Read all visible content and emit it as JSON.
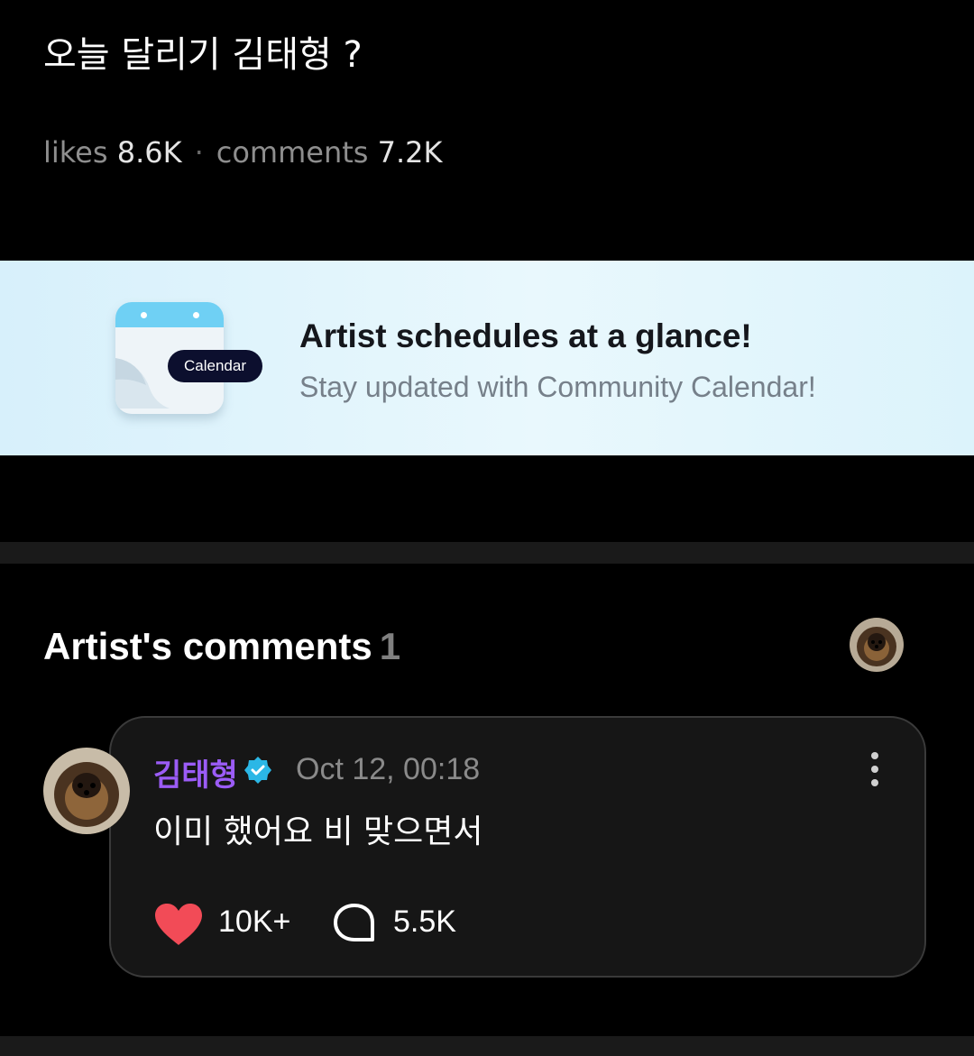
{
  "post": {
    "title": "오늘 달리기 김태형 ?",
    "likes_label": "likes",
    "likes_value": "8.6K",
    "separator": "·",
    "comments_label": "comments",
    "comments_value": "7.2K"
  },
  "banner": {
    "icon_badge": "Calendar",
    "headline": "Artist schedules at a glance!",
    "subtext": "Stay updated with Community Calendar!",
    "colors": {
      "header": "#6fd0f4",
      "badge": "#0c0f2e",
      "background": "#e4f5fc"
    }
  },
  "artist_comments": {
    "title": "Artist's comments",
    "count": "1",
    "avatar_icon": "pomeranian-avatar"
  },
  "comment": {
    "author": "김태형",
    "author_color": "#9b5cf6",
    "verified_icon": "verified-badge-icon",
    "timestamp": "Oct 12, 00:18",
    "text": "이미 했어요 비 맞으면서",
    "like_icon": "heart-icon",
    "like_color": "#f24b57",
    "likes": "10K+",
    "reply_icon": "speech-bubble-icon",
    "replies": "5.5K",
    "menu_icon": "more-vertical-icon"
  }
}
